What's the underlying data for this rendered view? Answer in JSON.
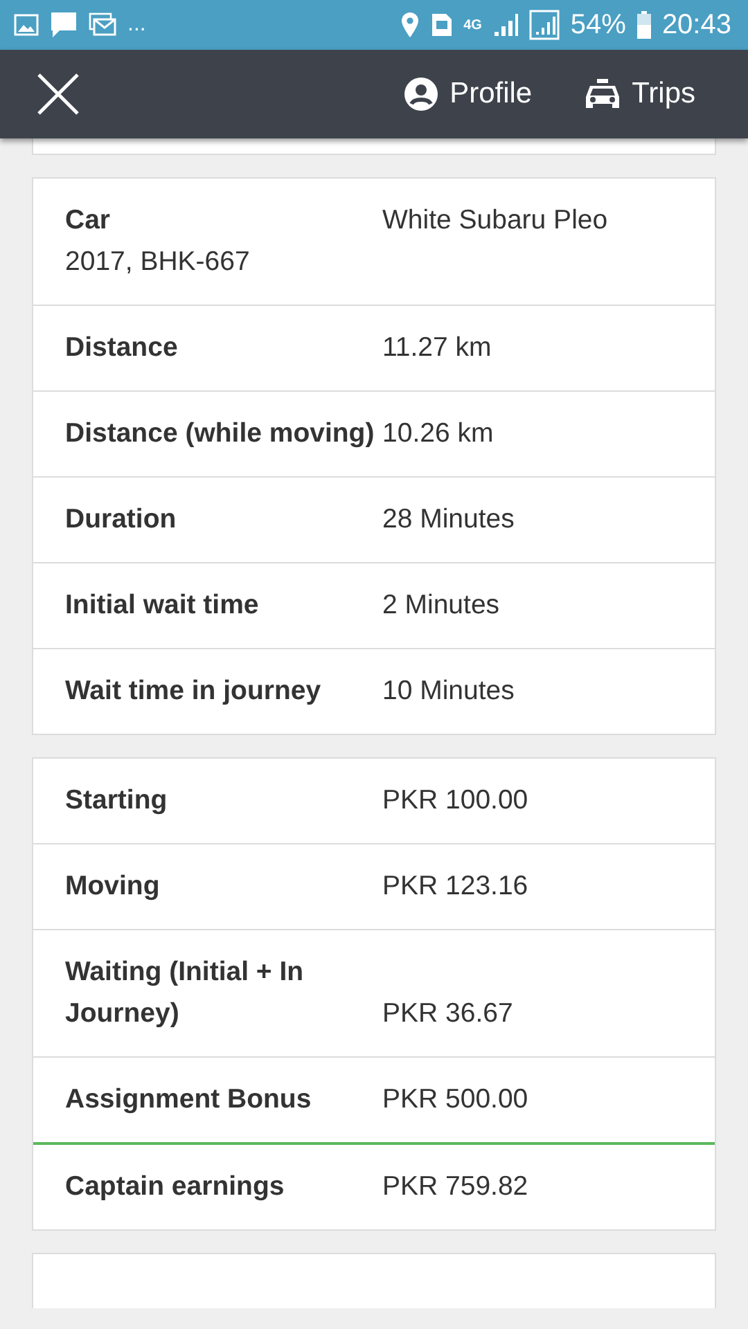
{
  "status_bar": {
    "more": "...",
    "network": "4G",
    "battery": "54%",
    "time": "20:43"
  },
  "nav": {
    "items": [
      {
        "kind": "profile",
        "label": "Profile"
      },
      {
        "kind": "trips",
        "label": "Trips"
      }
    ]
  },
  "trip_details": [
    {
      "label": "Car",
      "subtitle": "2017, BHK-667",
      "value": "White Subaru Pleo"
    },
    {
      "label": "Distance",
      "value": "11.27 km"
    },
    {
      "label": "Distance (while moving)",
      "value": "10.26 km"
    },
    {
      "label": "Duration",
      "value": "28 Minutes"
    },
    {
      "label": "Initial wait time",
      "value": "2 Minutes"
    },
    {
      "label": "Wait time in journey",
      "value": "10 Minutes"
    }
  ],
  "fare": [
    {
      "label": "Starting",
      "value": "PKR 100.00",
      "kind": "item"
    },
    {
      "label": "Moving",
      "value": "PKR 123.16",
      "kind": "item"
    },
    {
      "label": "Waiting (Initial + In Journey)",
      "value": "PKR 36.67",
      "kind": "item"
    },
    {
      "label": "Assignment Bonus",
      "value": "PKR 500.00",
      "kind": "item"
    },
    {
      "label": "Captain earnings",
      "value": "PKR 759.82",
      "kind": "total"
    }
  ]
}
